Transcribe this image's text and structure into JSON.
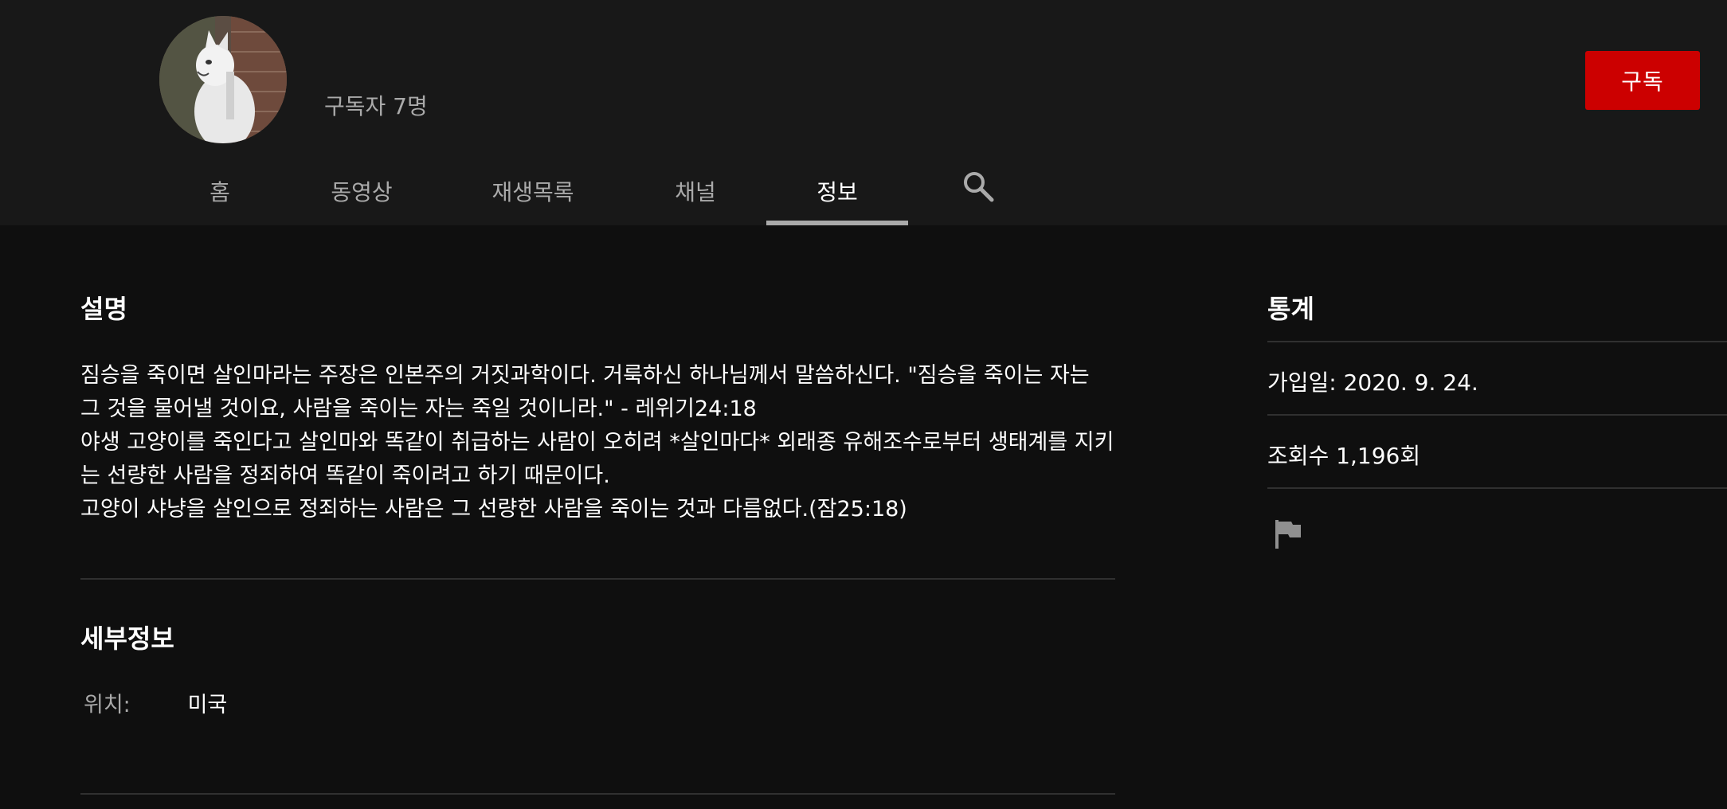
{
  "channel": {
    "subscriber_count": "구독자 7명",
    "subscribe_label": "구독"
  },
  "tabs": [
    {
      "label": "홈"
    },
    {
      "label": "동영상"
    },
    {
      "label": "재생목록"
    },
    {
      "label": "채널"
    },
    {
      "label": "정보",
      "active": true
    }
  ],
  "icons": {
    "search": "search-icon",
    "flag": "flag-icon",
    "avatar": "cat-avatar"
  },
  "about": {
    "description_heading": "설명",
    "description_lines": [
      "짐승을 죽이면 살인마라는 주장은 인본주의 거짓과학이다. 거룩하신 하나님께서 말씀하신다. \"짐승을 죽이는 자는 그 것을 물어낼 것이요, 사람을 죽이는 자는 죽일 것이니라.\" - 레위기24:18",
      "야생 고양이를 죽인다고 살인마와 똑같이 취급하는 사람이 오히려 *살인마다*  외래종 유해조수로부터 생태계를 지키는 선량한 사람을 정죄하여 똑같이 죽이려고 하기 때문이다.",
      "고양이 샤냥을 살인으로 정죄하는 사람은 그 선량한 사람을 죽이는 것과 다름없다.(잠25:18)"
    ],
    "details_heading": "세부정보",
    "location_label": "위치:",
    "location_value": "미국"
  },
  "stats": {
    "heading": "통계",
    "joined": "가입일: 2020. 9. 24.",
    "views": "조회수 1,196회"
  },
  "colors": {
    "background": "#0f0f0f",
    "header_background": "#181818",
    "subscribe_red": "#cc0000",
    "muted_text": "#aaaaaa",
    "divider": "#303030"
  }
}
